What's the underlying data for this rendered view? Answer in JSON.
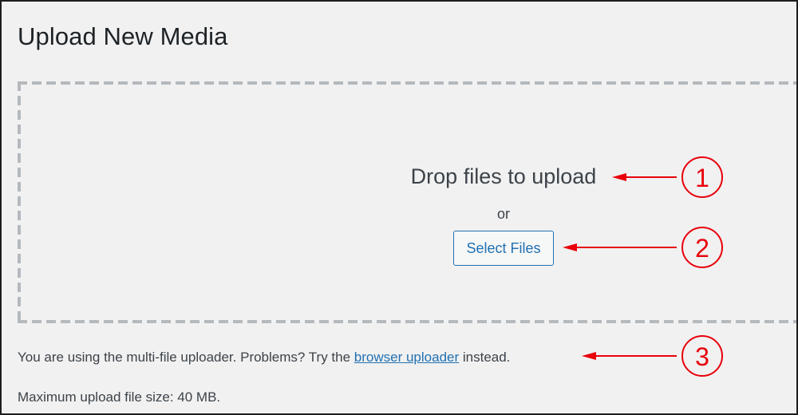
{
  "page": {
    "title": "Upload New Media"
  },
  "uploader": {
    "drop_instructions": "Drop files to upload",
    "or_label": "or",
    "select_button_label": "Select Files",
    "info_prefix": "You are using the multi-file uploader. Problems? Try the ",
    "info_link_label": "browser uploader",
    "info_suffix": " instead.",
    "max_size_text": "Maximum upload file size: 40 MB."
  },
  "annotations": {
    "color": "#e8000b",
    "callouts": [
      {
        "number": "1",
        "target": "drop-instructions"
      },
      {
        "number": "2",
        "target": "select-files-button"
      },
      {
        "number": "3",
        "target": "browser-uploader-link"
      }
    ]
  }
}
